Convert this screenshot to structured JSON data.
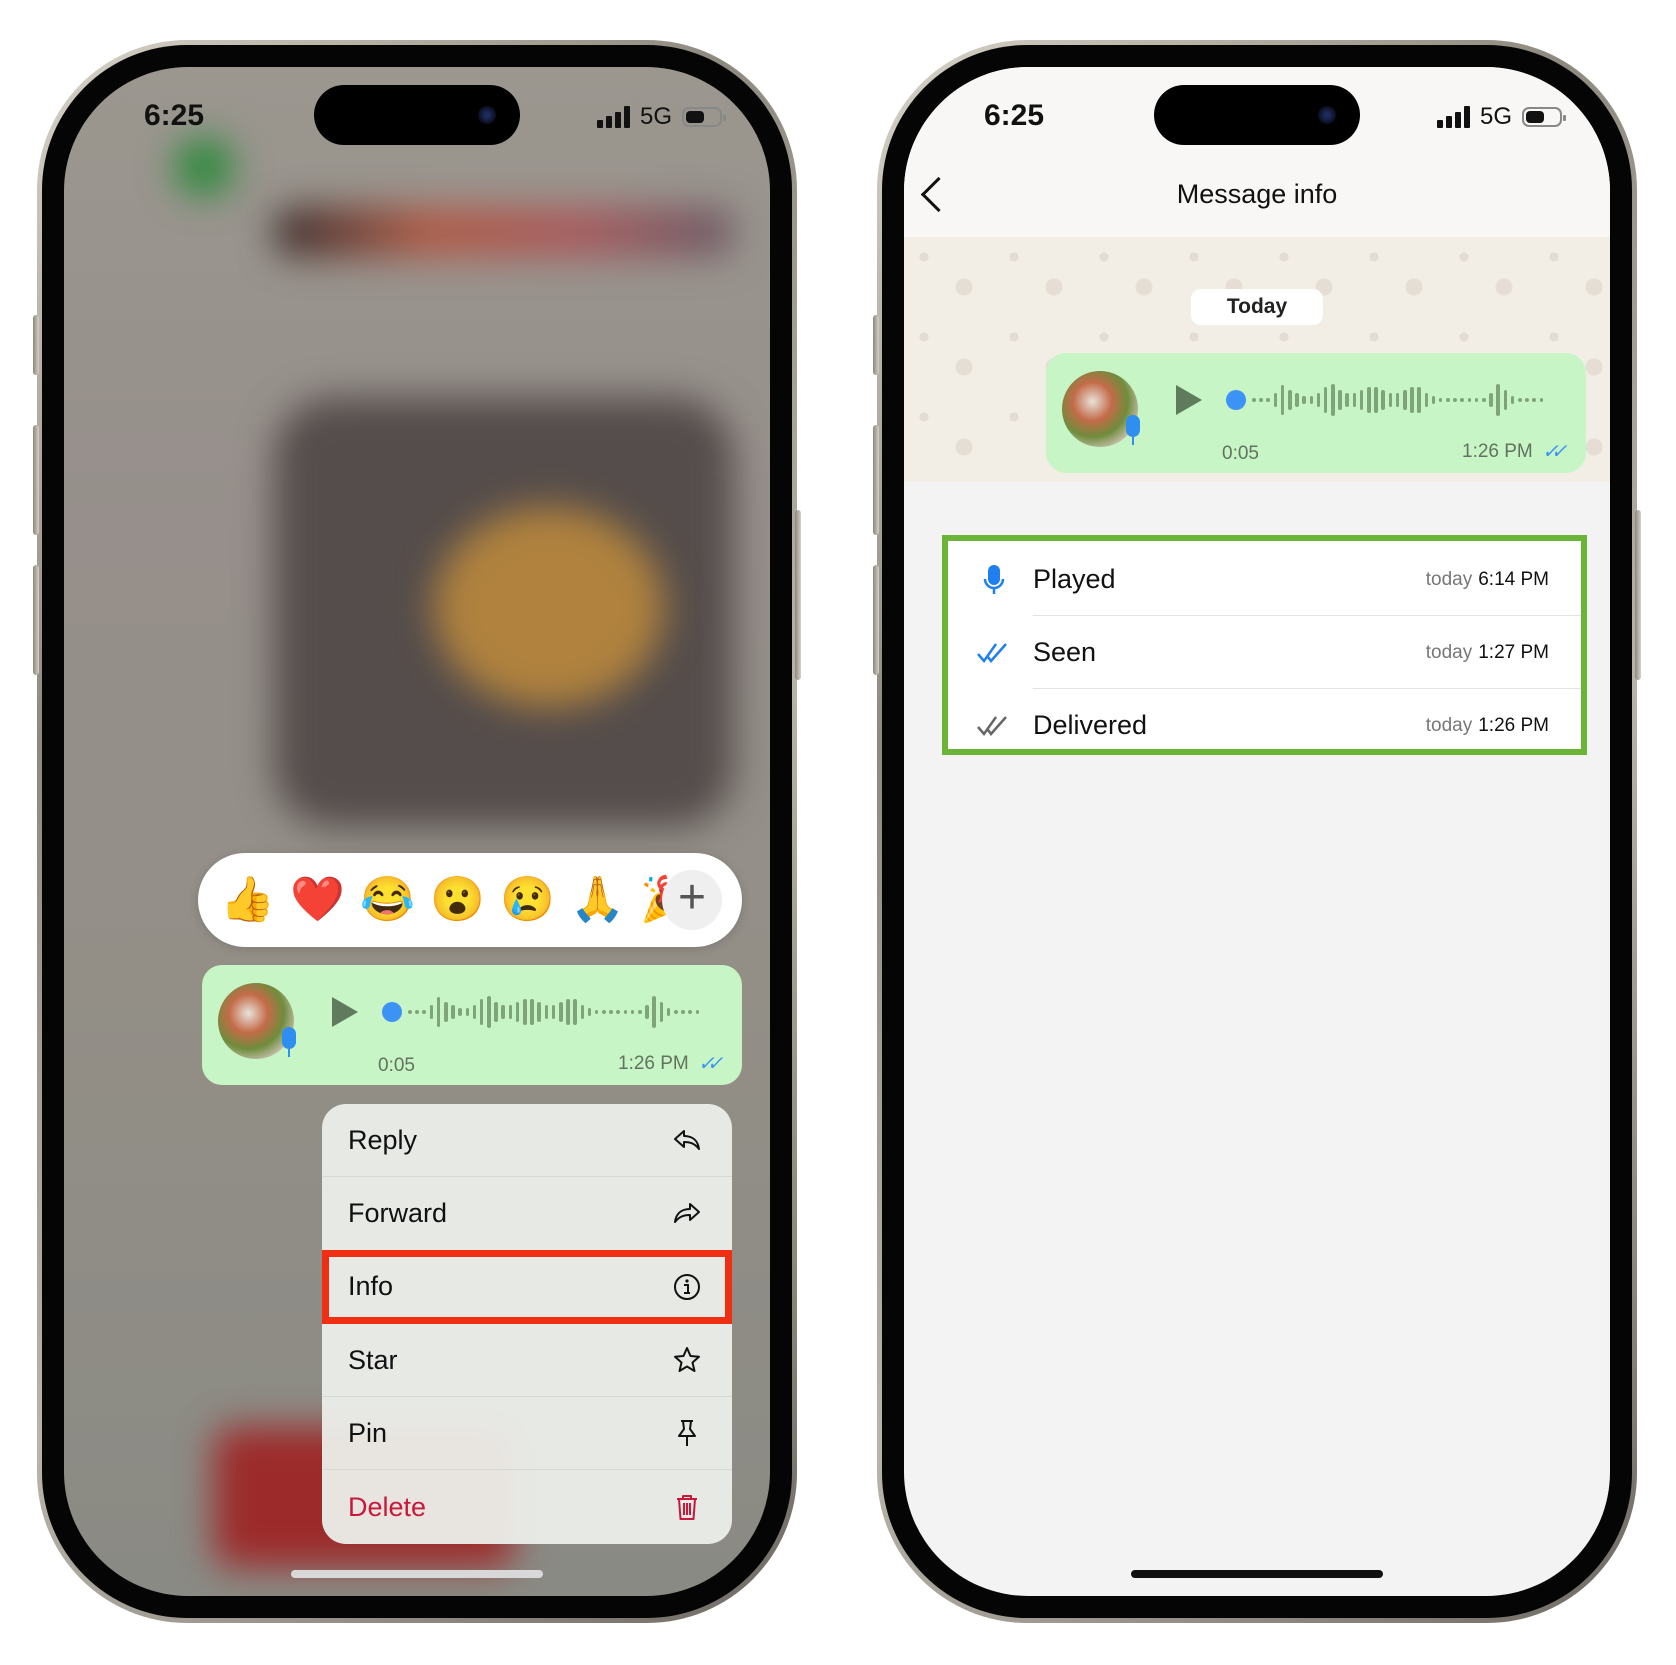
{
  "left_phone": {
    "status_bar": {
      "time": "6:25",
      "network": "5G"
    },
    "reactions": {
      "emojis": [
        "👍",
        "❤️",
        "😂",
        "😮",
        "😢",
        "🙏",
        "🎉"
      ],
      "more_label": "+"
    },
    "voice_message": {
      "duration": "0:05",
      "time": "1:26 PM",
      "ticks": "✓✓",
      "ticks_color": "#3d93f5"
    },
    "context_menu": {
      "items": [
        {
          "label": "Reply",
          "icon": "reply-icon"
        },
        {
          "label": "Forward",
          "icon": "forward-icon"
        },
        {
          "label": "Info",
          "icon": "info-icon",
          "highlighted": true
        },
        {
          "label": "Star",
          "icon": "star-icon"
        },
        {
          "label": "Pin",
          "icon": "pin-icon"
        },
        {
          "label": "Delete",
          "icon": "trash-icon",
          "destructive": true
        }
      ],
      "highlight_color": "#f02e12",
      "destructive_color": "#c8193c"
    }
  },
  "right_phone": {
    "status_bar": {
      "time": "6:25",
      "network": "5G"
    },
    "nav": {
      "title": "Message info",
      "back_icon": "chevron-left-icon"
    },
    "date_pill": "Today",
    "voice_message": {
      "duration": "0:05",
      "time": "1:26 PM",
      "ticks": "✓✓"
    },
    "receipts": [
      {
        "label": "Played",
        "day": "today",
        "time": "6:14 PM",
        "icon": "mic-icon"
      },
      {
        "label": "Seen",
        "day": "today",
        "time": "1:27 PM",
        "icon": "double-check-blue-icon"
      },
      {
        "label": "Delivered",
        "day": "today",
        "time": "1:26 PM",
        "icon": "double-check-gray-icon"
      }
    ],
    "highlight_color": "#6ab437"
  }
}
